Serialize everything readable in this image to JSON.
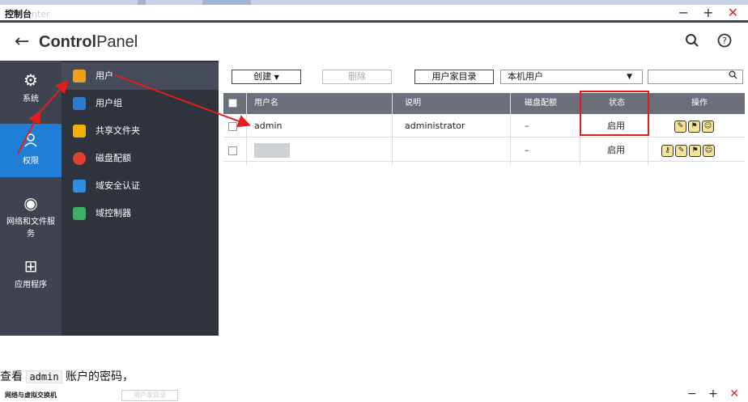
{
  "window": {
    "title": "控制台",
    "title_ghost": "nter",
    "controls": {
      "minimize": "−",
      "maximize": "+",
      "close": "✕"
    }
  },
  "header": {
    "back_icon": "←",
    "title_bold": "Control",
    "title_rest": "Panel",
    "search_icon": "search-icon",
    "help_icon": "help-icon"
  },
  "rail": {
    "items": [
      {
        "label": "系统",
        "icon": "gear-icon",
        "glyph": "⚙"
      },
      {
        "label": "权限",
        "icon": "user-icon",
        "glyph": "👤"
      },
      {
        "label": "网络和文件服务",
        "icon": "globe-icon",
        "glyph": "◉"
      },
      {
        "label": "应用程序",
        "icon": "apps-icon",
        "glyph": "⊞"
      }
    ]
  },
  "submenu": {
    "items": [
      {
        "label": "用户",
        "icon": "user-icon",
        "color": "#f0a020"
      },
      {
        "label": "用户组",
        "icon": "group-icon",
        "color": "#2e7bd0"
      },
      {
        "label": "共享文件夹",
        "icon": "share-folder-icon",
        "color": "#f0b000"
      },
      {
        "label": "磁盘配额",
        "icon": "quota-icon",
        "color": "#e04030"
      },
      {
        "label": "域安全认证",
        "icon": "domain-auth-icon",
        "color": "#2e8fe0"
      },
      {
        "label": "域控制器",
        "icon": "domain-controller-icon",
        "color": "#3cb060"
      }
    ]
  },
  "toolbar": {
    "create_label": "创建",
    "delete_label": "删除",
    "home_folder_label": "用户家目录",
    "user_type_selected": "本机用户",
    "search_placeholder": ""
  },
  "table": {
    "headers": [
      "用户名",
      "说明",
      "磁盘配额",
      "状态",
      "操作"
    ],
    "rows": [
      {
        "username": "admin",
        "description": "administrator",
        "quota": "–",
        "status": "启用"
      },
      {
        "username": "",
        "description": "",
        "quota": "–",
        "status": "启用"
      }
    ]
  },
  "annotation": {
    "caption_before": "查看",
    "caption_code": "admin",
    "caption_after": "账户的密码，",
    "highlight_color": "#e31c1c"
  },
  "bottom_window": {
    "title": "网络与虚拟交换机",
    "ghost_button": "用户家目录"
  }
}
